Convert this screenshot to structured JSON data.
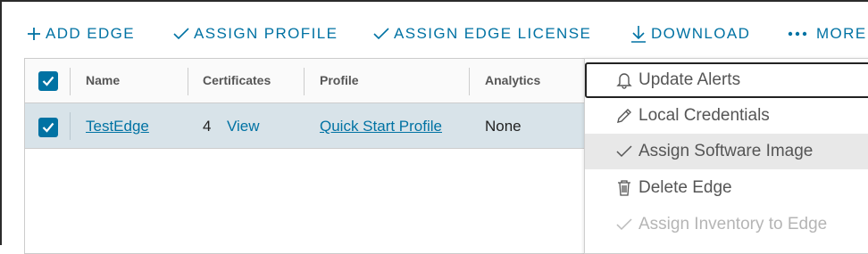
{
  "toolbar": {
    "add_edge": "ADD EDGE",
    "assign_profile": "ASSIGN PROFILE",
    "assign_edge_license": "ASSIGN EDGE LICENSE",
    "download": "DOWNLOAD",
    "more": "MORE"
  },
  "grid": {
    "columns": [
      "Name",
      "Certificates",
      "Profile",
      "Analytics"
    ],
    "rows": [
      {
        "name": "TestEdge",
        "cert_count": "4",
        "cert_link": "View",
        "profile": "Quick Start Profile",
        "analytics": "None",
        "selected": true
      }
    ]
  },
  "menu": {
    "items": [
      {
        "label": "Update Alerts",
        "icon": "bell-icon",
        "state": "focused"
      },
      {
        "label": "Local Credentials",
        "icon": "pencil-icon",
        "state": "normal"
      },
      {
        "label": "Assign Software Image",
        "icon": "check-icon",
        "state": "hover"
      },
      {
        "label": "Delete Edge",
        "icon": "trash-icon",
        "state": "normal"
      },
      {
        "label": "Assign Inventory to Edge",
        "icon": "check-icon",
        "state": "disabled"
      }
    ]
  },
  "colors": {
    "accent": "#0072a3",
    "row_selected": "#d8e3e9",
    "menu_hover": "#e8e8e8",
    "disabled_text": "#b5b5b5"
  }
}
